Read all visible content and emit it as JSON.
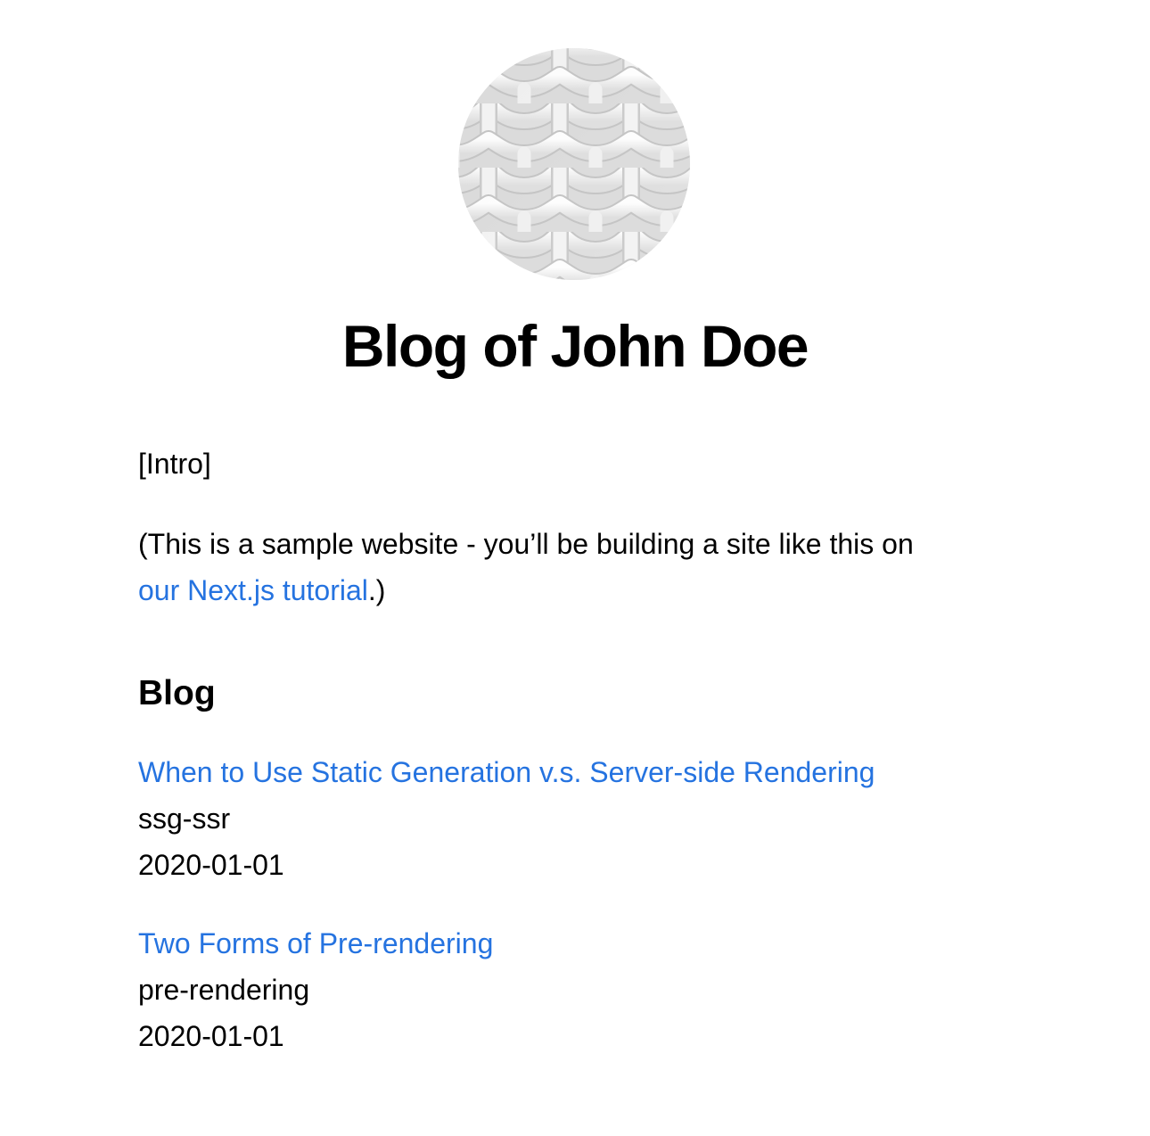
{
  "header": {
    "title": "Blog of John Doe"
  },
  "intro": {
    "text": "[Intro]",
    "note_prefix": "(This is a sample website - you’ll be building a site like this on",
    "note_link": "our Next.js tutorial",
    "note_suffix": ".)"
  },
  "blog": {
    "section_title": "Blog",
    "posts": [
      {
        "title": "When to Use Static Generation v.s. Server-side Rendering",
        "id": "ssg-ssr",
        "date": "2020-01-01"
      },
      {
        "title": "Two Forms of Pre-rendering",
        "id": "pre-rendering",
        "date": "2020-01-01"
      }
    ]
  },
  "colors": {
    "link": "#2573e0",
    "text": "#000000",
    "background": "#ffffff"
  }
}
